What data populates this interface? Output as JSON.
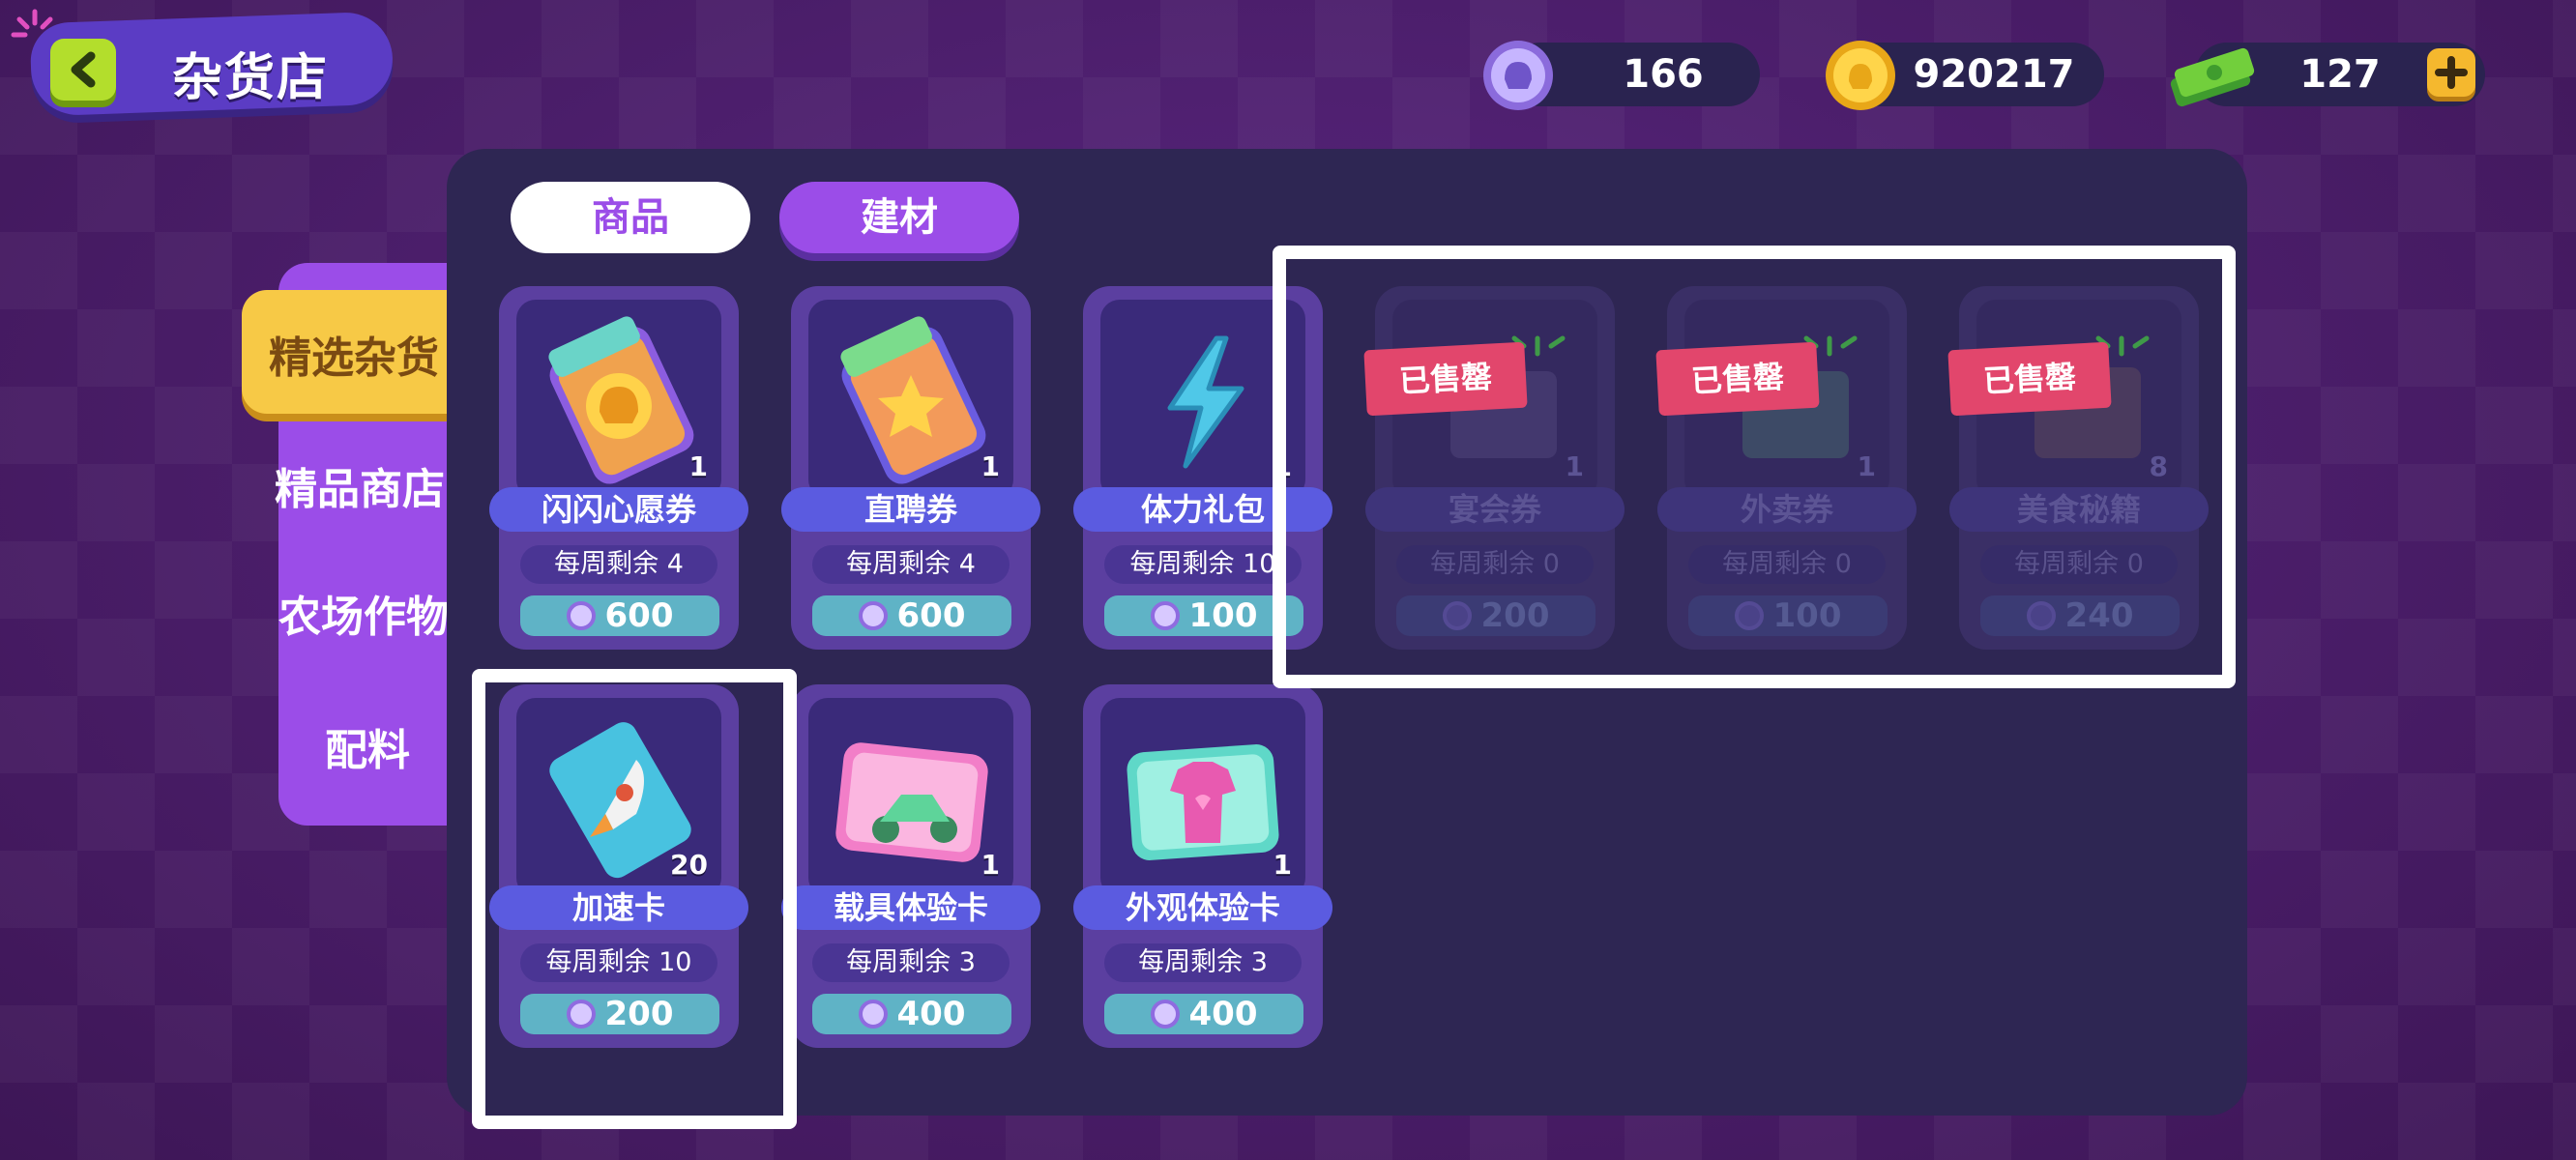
{
  "header": {
    "title": "杂货店"
  },
  "currencies": [
    {
      "icon": "gem-token-icon",
      "value": "166"
    },
    {
      "icon": "gold-coin-icon",
      "value": "920217"
    },
    {
      "icon": "cash-stack-icon",
      "value": "127"
    }
  ],
  "top_tabs": [
    {
      "label": "商品",
      "active": true
    },
    {
      "label": "建材",
      "active": false
    }
  ],
  "side_tabs": [
    {
      "label": "精选杂货",
      "active": true
    },
    {
      "label": "精品商店"
    },
    {
      "label": "农场作物"
    },
    {
      "label": "配料"
    }
  ],
  "items": [
    {
      "name": "闪闪心愿券",
      "qty": "1",
      "limit": "每周剩余 4",
      "price": "600",
      "sold_out": false,
      "icon": "wish-ticket-icon"
    },
    {
      "name": "直聘券",
      "qty": "1",
      "limit": "每周剩余 4",
      "price": "600",
      "sold_out": false,
      "icon": "hire-ticket-icon"
    },
    {
      "name": "体力礼包",
      "qty": "1",
      "limit": "每周剩余 10",
      "price": "100",
      "sold_out": false,
      "icon": "lightning-icon"
    },
    {
      "name": "宴会券",
      "qty": "1",
      "limit": "每周剩余 0",
      "price": "200",
      "sold_out": true,
      "icon": "banquet-box-icon"
    },
    {
      "name": "外卖券",
      "qty": "1",
      "limit": "每周剩余 0",
      "price": "100",
      "sold_out": true,
      "icon": "takeout-box-icon"
    },
    {
      "name": "美食秘籍",
      "qty": "8",
      "limit": "每周剩余 0",
      "price": "240",
      "sold_out": true,
      "icon": "recipe-book-icon"
    },
    {
      "name": "加速卡",
      "qty": "20",
      "limit": "每周剩余 10",
      "price": "200",
      "sold_out": false,
      "icon": "rocket-card-icon"
    },
    {
      "name": "载具体验卡",
      "qty": "1",
      "limit": "每周剩余 3",
      "price": "400",
      "sold_out": false,
      "icon": "scooter-card-icon"
    },
    {
      "name": "外观体验卡",
      "qty": "1",
      "limit": "每周剩余 3",
      "price": "400",
      "sold_out": false,
      "icon": "outfit-card-icon"
    }
  ],
  "sold_out_label": "已售罄",
  "colors": {
    "panel": "#2e2653",
    "accent_purple": "#9b4de8",
    "active_yellow": "#f7c946",
    "price_teal": "#5fb3c6",
    "sold_red": "#e2466c"
  }
}
